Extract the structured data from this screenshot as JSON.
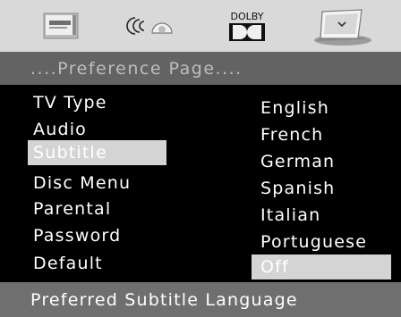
{
  "toolbar": {
    "icons": [
      "general-setup-icon",
      "speaker-setup-icon",
      "dolby-audio-icon",
      "preference-setup-icon"
    ],
    "dolby_text": "DOLBY"
  },
  "title": "....Preference Page....",
  "menu": {
    "items": [
      {
        "label": "TV Type"
      },
      {
        "label": "Audio"
      },
      {
        "label": "Subtitle"
      },
      {
        "label": "Disc Menu"
      },
      {
        "label": "Parental"
      },
      {
        "label": "Password"
      },
      {
        "label": "Default"
      }
    ],
    "selected": "Subtitle"
  },
  "options": {
    "items": [
      {
        "label": "English"
      },
      {
        "label": "French"
      },
      {
        "label": "German"
      },
      {
        "label": "Spanish"
      },
      {
        "label": "Italian"
      },
      {
        "label": "Portuguese"
      },
      {
        "label": "Off"
      }
    ],
    "selected": "Off"
  },
  "status": "Preferred Subtitle Language",
  "colors": {
    "toolbar_bg": "#d9d9d9",
    "title_bg": "#636363",
    "title_text": "#bdbdbd",
    "highlight_bg": "#d4d4d4",
    "status_bg": "#6f6f6f",
    "text": "#ffffff",
    "background": "#000000"
  }
}
